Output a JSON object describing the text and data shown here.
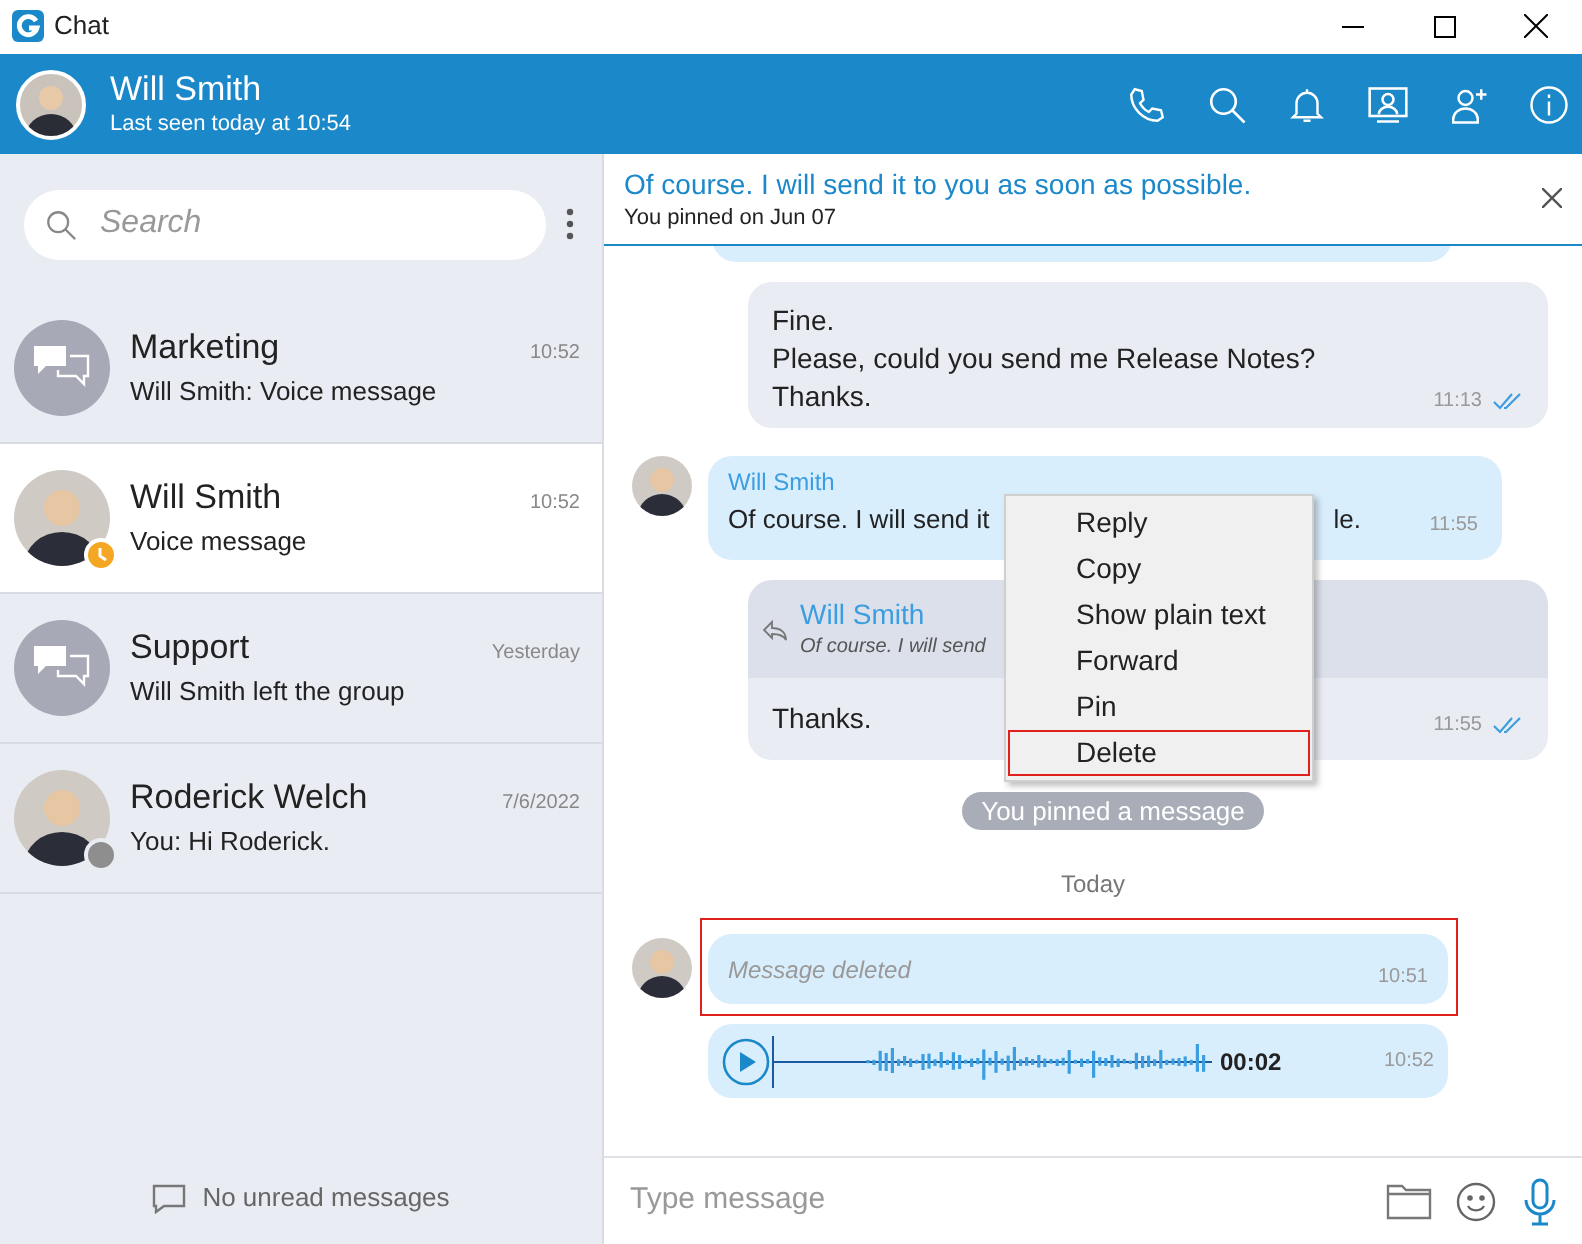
{
  "window": {
    "title": "Chat"
  },
  "header": {
    "name": "Will Smith",
    "subtitle": "Last seen today at 10:54"
  },
  "search": {
    "placeholder": "Search"
  },
  "chats": [
    {
      "kind": "group",
      "name": "Marketing",
      "time": "10:52",
      "preview": "Will Smith: Voice message",
      "selected": false
    },
    {
      "kind": "person",
      "name": "Will Smith",
      "time": "10:52",
      "preview": "Voice message",
      "selected": true,
      "away": true,
      "color": "#f5a623"
    },
    {
      "kind": "group",
      "name": "Support",
      "time": "Yesterday",
      "preview": "Will Smith left the group",
      "selected": false
    },
    {
      "kind": "person",
      "name": "Roderick Welch",
      "time": "7/6/2022",
      "preview": "You: Hi Roderick.",
      "selected": false,
      "away": false,
      "color": "#8e8e8e"
    }
  ],
  "sidebar_footer": "No unread messages",
  "pinned": {
    "text": "Of course. I will send it to you as soon as possible.",
    "note": "You pinned on Jun 07"
  },
  "messages": [
    {
      "kind": "outgoing",
      "lines": [
        "Fine.",
        "Please, could you send me Release Notes?",
        "Thanks."
      ],
      "time": "11:13",
      "read": true
    },
    {
      "kind": "incoming",
      "sender": "Will Smith",
      "text": "Of course. I will send it",
      "text_after": "le.",
      "time": "11:55"
    },
    {
      "kind": "reply",
      "quote_sender": "Will Smith",
      "quote": "Of course. I will send",
      "text": "Thanks.",
      "time": "11:55",
      "read": true
    },
    {
      "kind": "system",
      "text": "You pinned a message"
    },
    {
      "kind": "date",
      "text": "Today"
    },
    {
      "kind": "deleted",
      "text": "Message deleted",
      "time": "10:51",
      "highlighted": true
    },
    {
      "kind": "voice",
      "duration": "00:02",
      "time": "10:52"
    }
  ],
  "context_menu": [
    {
      "label": "Reply",
      "selected": false
    },
    {
      "label": "Copy",
      "selected": false
    },
    {
      "label": "Show plain text",
      "selected": false
    },
    {
      "label": "Forward",
      "selected": false
    },
    {
      "label": "Pin",
      "selected": false
    },
    {
      "label": "Delete",
      "selected": true
    }
  ],
  "composer": {
    "placeholder": "Type message"
  }
}
